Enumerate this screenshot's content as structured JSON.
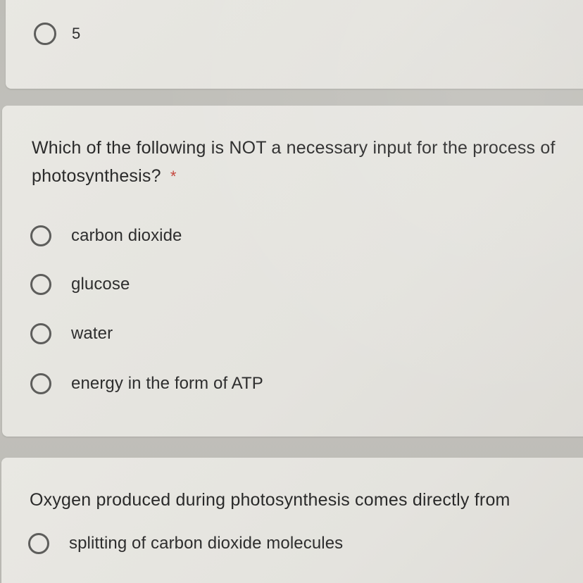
{
  "top_card": {
    "option": {
      "label": "5",
      "selected": false
    }
  },
  "question_1": {
    "text": "Which of the following is NOT a necessary input for the process of",
    "text_line2": "photosynthesis?",
    "required_marker": "*",
    "options": [
      {
        "label": "carbon dioxide",
        "selected": false
      },
      {
        "label": "glucose",
        "selected": false
      },
      {
        "label": "water",
        "selected": false
      },
      {
        "label": "energy in the form of ATP",
        "selected": false
      }
    ]
  },
  "question_2": {
    "text": "Oxygen produced during photosynthesis comes directly from",
    "options": [
      {
        "label": "splitting of carbon dioxide molecules",
        "selected": false
      }
    ]
  },
  "colors": {
    "card_background": "#e7e6e1",
    "page_background": "#bfbeb8",
    "text": "#2a2a2a",
    "radio_border": "#5d5d5b",
    "required": "#c5453c"
  },
  "icons": {
    "radio": "radio-button-unchecked-icon"
  }
}
